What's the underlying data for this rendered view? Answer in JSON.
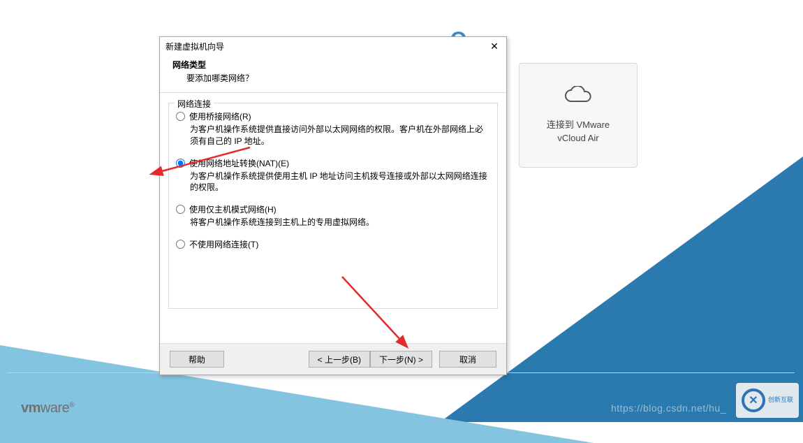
{
  "background": {
    "title_partial_left": "",
    "title_partial_right": "O"
  },
  "vcloud": {
    "line1": "连接到 VMware",
    "line2": "vCloud Air"
  },
  "vmware_logo": {
    "part1": "vm",
    "part2": "ware",
    "reg": "®"
  },
  "watermark": {
    "text": "创新互联",
    "url": "https://blog.csdn.net/hu_"
  },
  "dialog": {
    "title": "新建虚拟机向导",
    "close_glyph": "✕",
    "header": {
      "title": "网络类型",
      "subtitle": "要添加哪类网络？"
    },
    "group_legend": "网络连接",
    "options": [
      {
        "label": "使用桥接网络(R)",
        "desc": "为客户机操作系统提供直接访问外部以太网网络的权限。客户机在外部网络上必须有自己的 IP 地址。",
        "checked": false
      },
      {
        "label": "使用网络地址转换(NAT)(E)",
        "desc": "为客户机操作系统提供使用主机 IP 地址访问主机拨号连接或外部以太网网络连接的权限。",
        "checked": true
      },
      {
        "label": "使用仅主机模式网络(H)",
        "desc": "将客户机操作系统连接到主机上的专用虚拟网络。",
        "checked": false
      },
      {
        "label": "不使用网络连接(T)",
        "desc": "",
        "checked": false
      }
    ],
    "buttons": {
      "help": "帮助",
      "back": "< 上一步(B)",
      "next": "下一步(N) >",
      "cancel": "取消"
    }
  }
}
